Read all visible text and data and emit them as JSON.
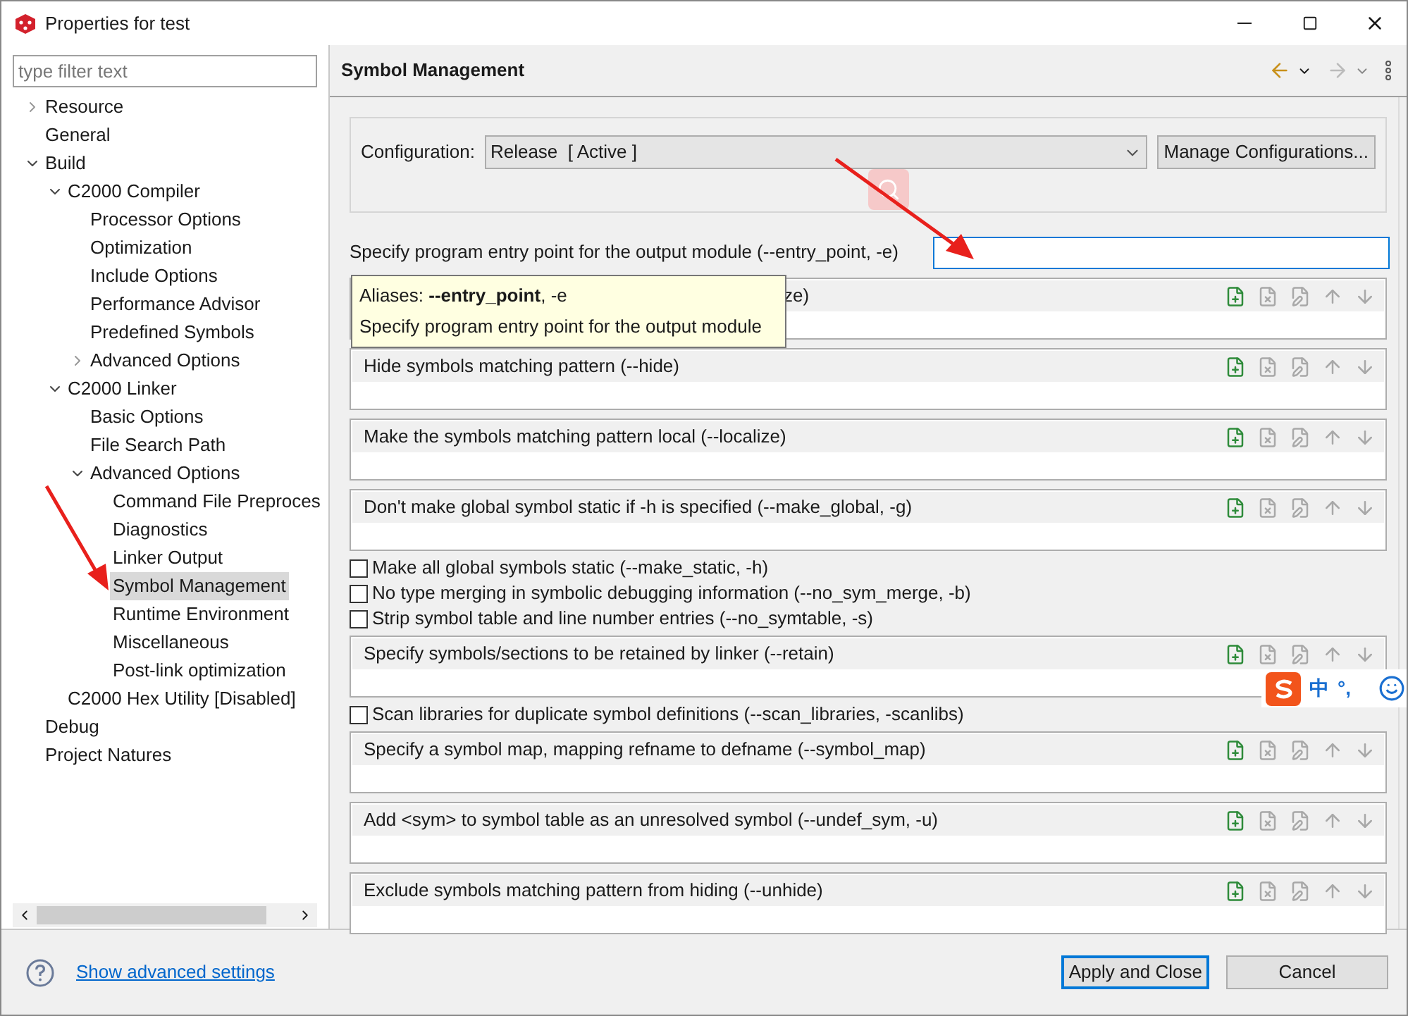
{
  "window": {
    "title": "Properties for test"
  },
  "filter": {
    "placeholder": "type filter text"
  },
  "tree": [
    {
      "label": "Resource",
      "expanded": false,
      "selected": false
    },
    {
      "label": "General",
      "selected": false
    },
    {
      "label": "Build",
      "expanded": true,
      "selected": false,
      "children": [
        {
          "label": "C2000 Compiler",
          "expanded": true,
          "selected": false,
          "children": [
            {
              "label": "Processor Options",
              "selected": false
            },
            {
              "label": "Optimization",
              "selected": false
            },
            {
              "label": "Include Options",
              "selected": false
            },
            {
              "label": "Performance Advisor",
              "selected": false
            },
            {
              "label": "Predefined Symbols",
              "selected": false
            },
            {
              "label": "Advanced Options",
              "expanded": false,
              "selected": false
            }
          ]
        },
        {
          "label": "C2000 Linker",
          "expanded": true,
          "selected": false,
          "children": [
            {
              "label": "Basic Options",
              "selected": false
            },
            {
              "label": "File Search Path",
              "selected": false
            },
            {
              "label": "Advanced Options",
              "expanded": true,
              "selected": false,
              "children": [
                {
                  "label": "Command File Preproces",
                  "selected": false
                },
                {
                  "label": "Diagnostics",
                  "selected": false
                },
                {
                  "label": "Linker Output",
                  "selected": false
                },
                {
                  "label": "Symbol Management",
                  "selected": true
                },
                {
                  "label": "Runtime Environment",
                  "selected": false
                },
                {
                  "label": "Miscellaneous",
                  "selected": false
                },
                {
                  "label": "Post-link optimization",
                  "selected": false
                }
              ]
            }
          ]
        },
        {
          "label": "C2000 Hex Utility  [Disabled]",
          "selected": false
        }
      ]
    },
    {
      "label": "Debug",
      "selected": false
    },
    {
      "label": "Project Natures",
      "selected": false
    }
  ],
  "page": {
    "title": "Symbol Management",
    "configuration": {
      "label": "Configuration:",
      "value": "Release  [ Active ]",
      "button": "Manage Configurations..."
    },
    "entry_point": {
      "label": "Specify program entry point for the output module (--entry_point, -e)",
      "focused": true
    },
    "tooltip": {
      "title": "Aliases: **--entry_point**, -e",
      "text": "Specify program entry point for the output module"
    },
    "options": [
      {
        "kind": "list_under_tooltip",
        "title": "ze)"
      },
      {
        "kind": "list",
        "title": "Hide symbols matching pattern (--hide)"
      },
      {
        "kind": "list",
        "title": "Make the symbols matching pattern local (--localize)"
      },
      {
        "kind": "list",
        "title": "Don't make global symbol static if -h is specified (--make_global, -g)"
      },
      {
        "kind": "check",
        "title": "Make all global symbols static (--make_static, -h)",
        "checked": false
      },
      {
        "kind": "check",
        "title": "No type merging in symbolic debugging information (--no_sym_merge, -b)",
        "checked": false
      },
      {
        "kind": "check",
        "title": "Strip symbol table and line number entries (--no_symtable, -s)",
        "checked": false
      },
      {
        "kind": "list",
        "title": "Specify symbols/sections to be retained by linker (--retain)"
      },
      {
        "kind": "check",
        "title": "Scan libraries for duplicate symbol definitions (--scan_libraries, -scanlibs)",
        "checked": false
      },
      {
        "kind": "list",
        "title": "Specify a symbol map, mapping refname to defname (--symbol_map)"
      },
      {
        "kind": "list",
        "title": "Add <sym> to symbol table as an unresolved symbol (--undef_sym, -u)"
      },
      {
        "kind": "list",
        "title": "Exclude symbols matching pattern from hiding (--unhide)"
      }
    ]
  },
  "ime_bar": {
    "mode": "中",
    "punctuation": "°,"
  },
  "footer": {
    "link": "Show advanced settings",
    "buttons": [
      {
        "label": "Apply and Close",
        "default": true
      },
      {
        "label": "Cancel",
        "default": false
      }
    ]
  }
}
